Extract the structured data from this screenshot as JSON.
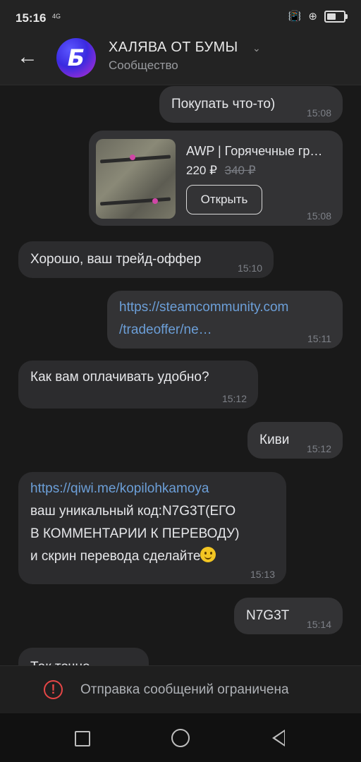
{
  "status_bar": {
    "time": "15:16",
    "network": "4G"
  },
  "header": {
    "title": "ХАЛЯВА ОТ БУМЫ",
    "subtitle": "Сообщество",
    "avatar_letter": "Б"
  },
  "messages": [
    {
      "dir": "out",
      "text": "Покупать что-то)",
      "time": "15:08"
    },
    {
      "dir": "out",
      "type": "product",
      "title": "AWP | Горячечные гр…",
      "price": "220 ₽",
      "old_price": "340 ₽",
      "button": "Открыть",
      "time": "15:08"
    },
    {
      "dir": "in",
      "text": "Хорошо, ваш трейд-оффер",
      "time": "15:10"
    },
    {
      "dir": "out",
      "link_line1": "https://steamcommunity.com",
      "link_line2": "/tradeoffer/ne…",
      "time": "15:11"
    },
    {
      "dir": "in",
      "text": "Как вам оплачивать удобно?",
      "time": "15:12"
    },
    {
      "dir": "out",
      "text": "Киви",
      "time": "15:12"
    },
    {
      "dir": "in",
      "link": "https://qiwi.me/kopilohkamoya",
      "line2": "ваш уникальный код:N7G3T(ЕГО",
      "line3": "В КОММЕНТАРИИ К ПЕРЕВОДУ)",
      "line4": "и скрин перевода сделайте",
      "emoji": "smile-emoji",
      "time": "15:13"
    },
    {
      "dir": "out",
      "text": "N7G3T",
      "time": "15:14"
    },
    {
      "dir": "in",
      "text": "Так точно",
      "time": ""
    }
  ],
  "restriction": {
    "text": "Отправка сообщений ограничена",
    "icon": "warning-icon"
  },
  "colors": {
    "link": "#6c9fd8",
    "warning": "#e64646",
    "bubble": "#2c2c2e",
    "background": "#191919"
  }
}
